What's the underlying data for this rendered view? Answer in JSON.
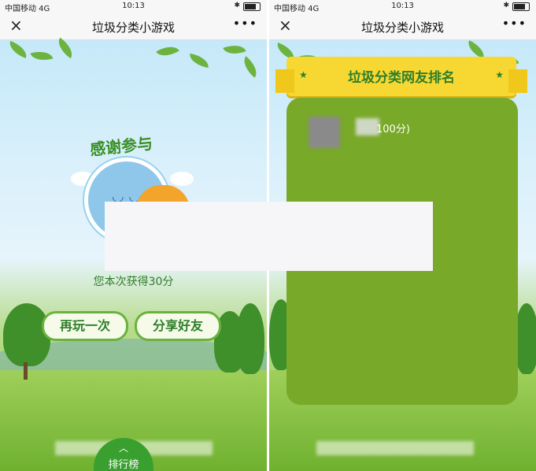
{
  "left_screen": {
    "status": {
      "carrier": "中国移动 4G",
      "time": "10:13"
    },
    "navbar": {
      "close_icon": "×",
      "title": "垃圾分类小游戏",
      "more_icon": "•••"
    },
    "thanks_text": "感谢参与",
    "score_text": "您本次获得30分",
    "play_again_label": "再玩一次",
    "share_label": "分享好友",
    "rank_tab": {
      "chevron": "︿",
      "label": "排行榜"
    }
  },
  "right_screen": {
    "status": {
      "carrier": "中国移动 4G",
      "time": "10:13"
    },
    "navbar": {
      "close_icon": "×",
      "title": "垃圾分类小游戏",
      "more_icon": "•••"
    },
    "ribbon_title": "垃圾分类网友排名",
    "ranking": [
      {
        "score_text": "100分)"
      }
    ]
  },
  "colors": {
    "green": "#39a030",
    "board": "#78a928",
    "ribbon": "#f7d832"
  }
}
